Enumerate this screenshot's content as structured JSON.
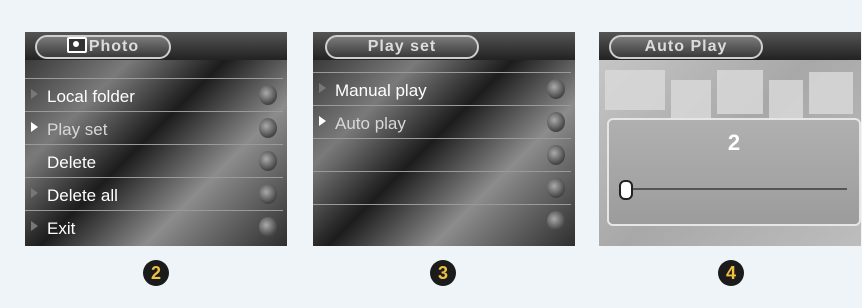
{
  "panel2": {
    "title": "Photo",
    "items": [
      {
        "label": "Local folder"
      },
      {
        "label": "Play set"
      },
      {
        "label": "Delete"
      },
      {
        "label": "Delete all"
      },
      {
        "label": "Exit"
      }
    ],
    "step": "2"
  },
  "panel3": {
    "title": "Play set",
    "items": [
      {
        "label": "Manual play"
      },
      {
        "label": "Auto play"
      },
      {
        "label": ""
      },
      {
        "label": ""
      },
      {
        "label": ""
      }
    ],
    "step": "3"
  },
  "panel4": {
    "title": "Auto Play",
    "value": "2",
    "slider_level": 0,
    "step": "4"
  },
  "icons": [
    "camera-icon",
    "arrow-icon"
  ]
}
